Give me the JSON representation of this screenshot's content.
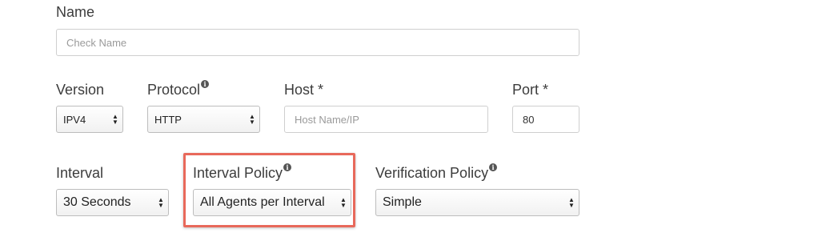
{
  "name": {
    "label": "Name",
    "placeholder": "Check Name"
  },
  "version": {
    "label": "Version",
    "value": "IPV4"
  },
  "protocol": {
    "label": "Protocol",
    "value": "HTTP"
  },
  "host": {
    "label": "Host *",
    "placeholder": "Host Name/IP"
  },
  "port": {
    "label": "Port *",
    "value": "80"
  },
  "interval": {
    "label": "Interval",
    "value": "30 Seconds"
  },
  "interval_policy": {
    "label": "Interval Policy",
    "value": "All Agents per Interval"
  },
  "verification_policy": {
    "label": "Verification Policy",
    "value": "Simple"
  },
  "icons": {
    "info": "info-icon",
    "select_arrows": "up-down-chevron-icon"
  },
  "colors": {
    "highlight_border": "#e8695b"
  }
}
